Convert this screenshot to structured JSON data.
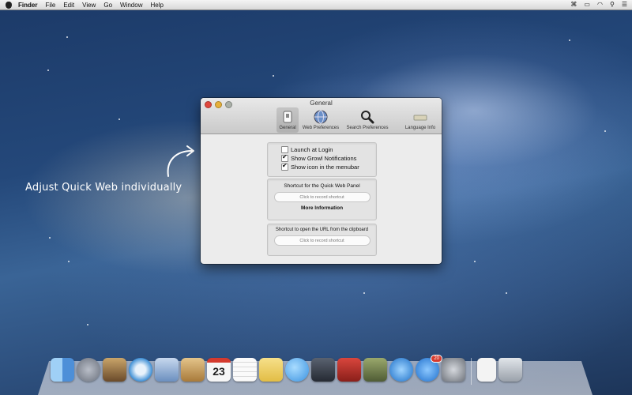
{
  "menubar": {
    "items": [
      "Finder",
      "File",
      "Edit",
      "View",
      "Go",
      "Window",
      "Help"
    ],
    "right_icons": [
      "command-icon",
      "battery-icon",
      "wifi-icon",
      "search-icon",
      "list-icon"
    ]
  },
  "annotation": "Adjust Quick Web individually",
  "window": {
    "title": "General",
    "toolbar": [
      {
        "label": "General",
        "icon": "switch-icon"
      },
      {
        "label": "Web Preferences",
        "icon": "globe-icon"
      },
      {
        "label": "Search Preferences",
        "icon": "magnifier-icon"
      },
      {
        "label": "Language Info",
        "icon": "keyboard-icon"
      }
    ],
    "checkboxes": [
      {
        "label": "Launch at Login",
        "checked": false
      },
      {
        "label": "Show Growl Notifications",
        "checked": true
      },
      {
        "label": "Show icon in the menubar",
        "checked": true
      }
    ],
    "shortcut_panel": {
      "title": "Shortcut for the Quick Web Panel",
      "recorder": "Click to record shortcut",
      "more_info": "More Information"
    },
    "clipboard_panel": {
      "title": "Shortcut to open the URL from the clipboard",
      "recorder": "Click to record shortcut"
    }
  },
  "dock": {
    "calendar_day": "23",
    "app_store_badge": "20",
    "apps": [
      {
        "name": "finder",
        "color": "#5aa6e8"
      },
      {
        "name": "launchpad",
        "color": "#8a8f9a"
      },
      {
        "name": "photo-browser",
        "color": "#7a5a3a"
      },
      {
        "name": "safari",
        "color": "#3d8fd6"
      },
      {
        "name": "mail",
        "color": "#6b8fbf"
      },
      {
        "name": "contacts",
        "color": "#c49a55"
      },
      {
        "name": "calendar",
        "color": "#f2f2f2"
      },
      {
        "name": "reminders",
        "color": "#f5f5f5"
      },
      {
        "name": "notes",
        "color": "#f1d36b"
      },
      {
        "name": "messages",
        "color": "#5ab0ee"
      },
      {
        "name": "facetime",
        "color": "#3a3f48"
      },
      {
        "name": "photo-booth",
        "color": "#b8332c"
      },
      {
        "name": "iphoto",
        "color": "#6c7c4f"
      },
      {
        "name": "itunes",
        "color": "#2d7fd6"
      },
      {
        "name": "app-store",
        "color": "#3a8fe0"
      },
      {
        "name": "system-preferences",
        "color": "#9a9ea6"
      },
      {
        "name": "documents",
        "color": "#ececec"
      },
      {
        "name": "trash",
        "color": "#b9bfc7"
      }
    ]
  }
}
